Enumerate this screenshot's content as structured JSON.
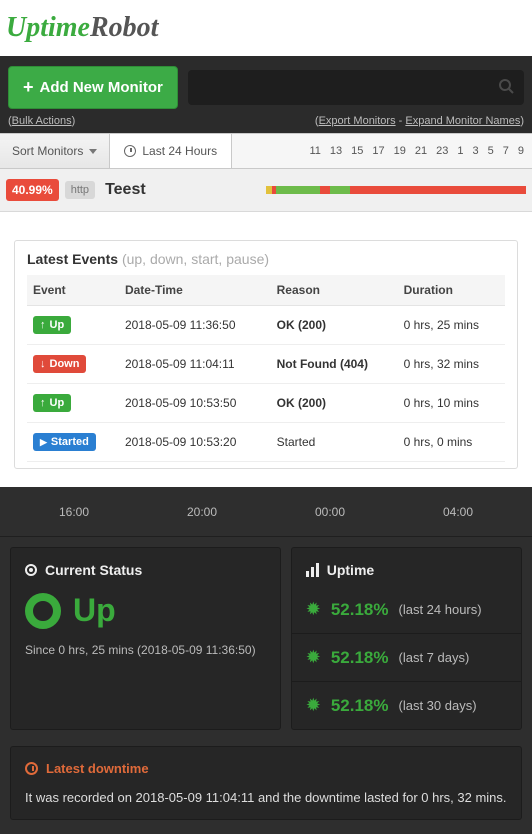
{
  "logo": {
    "part1": "Uptime",
    "part2": "Robot"
  },
  "toolbar": {
    "add_label": "Add New Monitor",
    "bulk_actions": "Bulk Actions",
    "export_monitors": "Export Monitors",
    "expand_names": "Expand Monitor Names",
    "search_placeholder": ""
  },
  "filter": {
    "sort_label": "Sort Monitors",
    "range_label": "Last 24 Hours",
    "hours": [
      "11",
      "13",
      "15",
      "17",
      "19",
      "21",
      "23",
      "1",
      "3",
      "5",
      "7",
      "9"
    ]
  },
  "monitor": {
    "uptime_pct": "40.99%",
    "type": "http",
    "name": "Teest"
  },
  "events": {
    "title": "Latest Events",
    "subtitle": "(up, down, start, pause)",
    "columns": {
      "event": "Event",
      "datetime": "Date-Time",
      "reason": "Reason",
      "duration": "Duration"
    },
    "rows": [
      {
        "kind": "up",
        "label": "Up",
        "datetime": "2018-05-09 11:36:50",
        "reason": "OK (200)",
        "reason_style": "ok",
        "duration": "0 hrs, 25 mins"
      },
      {
        "kind": "down",
        "label": "Down",
        "datetime": "2018-05-09 11:04:11",
        "reason": "Not Found (404)",
        "reason_style": "err",
        "duration": "0 hrs, 32 mins"
      },
      {
        "kind": "up",
        "label": "Up",
        "datetime": "2018-05-09 10:53:50",
        "reason": "OK (200)",
        "reason_style": "ok",
        "duration": "0 hrs, 10 mins"
      },
      {
        "kind": "started",
        "label": "Started",
        "datetime": "2018-05-09 10:53:20",
        "reason": "Started",
        "reason_style": "plain",
        "duration": "0 hrs, 0 mins"
      }
    ]
  },
  "timeline": {
    "ticks": [
      "16:00",
      "20:00",
      "00:00",
      "04:00"
    ]
  },
  "status": {
    "title": "Current Status",
    "value": "Up",
    "since": "Since 0 hrs, 25 mins (2018-05-09 11:36:50)"
  },
  "uptime": {
    "title": "Uptime",
    "rows": [
      {
        "pct": "52.18%",
        "range": "(last 24 hours)"
      },
      {
        "pct": "52.18%",
        "range": "(last 7 days)"
      },
      {
        "pct": "52.18%",
        "range": "(last 30 days)"
      }
    ]
  },
  "downtime": {
    "title": "Latest downtime",
    "text": "It was recorded on 2018-05-09 11:04:11 and the downtime lasted for 0 hrs, 32 mins."
  }
}
